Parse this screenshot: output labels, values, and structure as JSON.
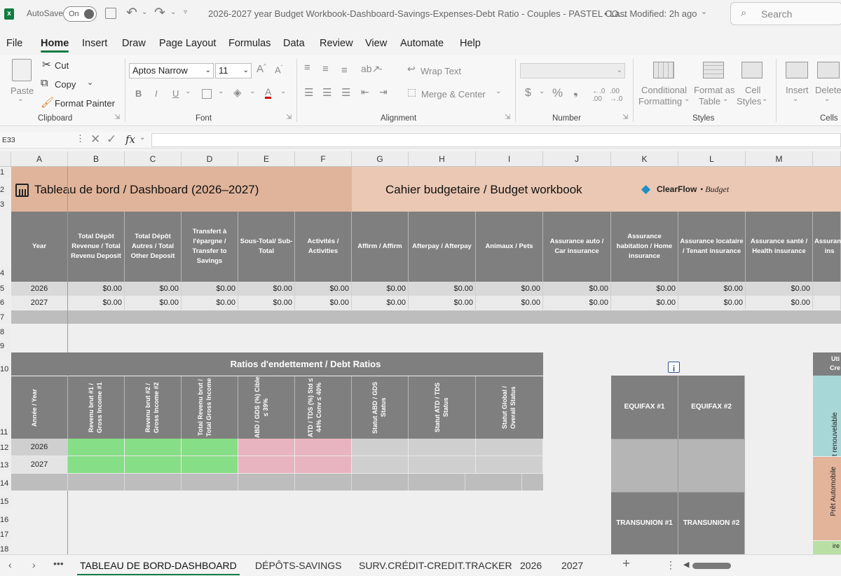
{
  "titlebar": {
    "autosave_label": "AutoSave",
    "autosave_state": "On",
    "doc_title": "2026-2027 year Budget Workbook-Dashboard-Savings-Expenses-Debt Ratio - Couples - PASTEL CO...",
    "last_modified": "• Last Modified: 2h ago",
    "search_placeholder": "Search"
  },
  "menu": [
    "File",
    "Home",
    "Insert",
    "Draw",
    "Page Layout",
    "Formulas",
    "Data",
    "Review",
    "View",
    "Automate",
    "Help"
  ],
  "ribbon": {
    "clipboard": {
      "paste": "Paste",
      "cut": "Cut",
      "copy": "Copy",
      "format_painter": "Format Painter",
      "group": "Clipboard"
    },
    "font": {
      "family": "Aptos Narrow",
      "size": "11",
      "group": "Font"
    },
    "alignment": {
      "wrap": "Wrap Text",
      "merge": "Merge & Center",
      "group": "Alignment"
    },
    "number": {
      "group": "Number"
    },
    "styles": {
      "conditional": "Conditional",
      "formatting": "Formatting",
      "format_as": "Format as",
      "table": "Table",
      "cell": "Cell",
      "styles": "Styles",
      "group": "Styles"
    },
    "cells": {
      "insert": "Insert",
      "delete": "Delete",
      "group": "Cells"
    }
  },
  "formula_bar": {
    "name_box": "E33",
    "fx": "fx"
  },
  "columns": [
    "A",
    "B",
    "C",
    "D",
    "E",
    "F",
    "G",
    "H",
    "I",
    "J",
    "K",
    "L",
    "M"
  ],
  "rows": [
    "1",
    "2",
    "3",
    "4",
    "5",
    "6",
    "7",
    "8",
    "9",
    "10",
    "11",
    "12",
    "13",
    "14",
    "15",
    "16",
    "17",
    "18"
  ],
  "sheet": {
    "dashboard_title": "Tableau de bord / Dashboard  (2026–2027)",
    "workbook_title": "Cahier budgetaire  / Budget workbook",
    "brand": "ClearFlow",
    "brand_suffix": "• Budget",
    "headers": [
      "Year",
      "Total Dépôt Revenue / Total Revenu Deposit",
      "Total Dépôt Autres / Total Other Deposit",
      "Transfert à l'épargne / Transfer to Savings",
      "Sous-Total/ Sub-Total",
      "Activités / Activities",
      "Affirm / Affirm",
      "Afterpay / Afterpay",
      "Animaux / Pets",
      "Assurance auto / Car insurance",
      "Assurance habitation / Home insurance",
      "Assurance locataire / Tenant insurance",
      "Assurance santé / Health insurance",
      "Assuranc ins"
    ],
    "data_rows": [
      {
        "year": "2026",
        "values": [
          "$0.00",
          "$0.00",
          "$0.00",
          "$0.00",
          "$0.00",
          "$0.00",
          "$0.00",
          "$0.00",
          "$0.00",
          "$0.00",
          "$0.00",
          "$0.00"
        ]
      },
      {
        "year": "2027",
        "values": [
          "$0.00",
          "$0.00",
          "$0.00",
          "$0.00",
          "$0.00",
          "$0.00",
          "$0.00",
          "$0.00",
          "$0.00",
          "$0.00",
          "$0.00",
          "$0.00"
        ]
      }
    ],
    "debt_title": "Ratios d'endettement / Debt Ratios",
    "debt_headers": [
      "Année / Year",
      "Revenu brut #1 / Gross Income #1",
      "Revenu brut #2 / Gross Income #2",
      "Total Revenu brut / Total Gross Income",
      "ABD / GDS (%) Cible ≤ 39%",
      "ATD / TDS (%) Std ≤ 44% Conv ≤ 40%",
      "Statut ABD / GDS Status",
      "Statut ATD / TDS Status",
      "Statut Global / Overall Status"
    ],
    "debt_years": [
      "2026",
      "2027"
    ],
    "credit": {
      "info": "i",
      "equifax1": "EQUIFAX #1",
      "equifax2": "EQUIFAX #2",
      "transunion1": "TRANSUNION #1",
      "transunion2": "TRANSUNION #2"
    },
    "side_labels": {
      "top_a": "Uti",
      "top_b": "Cre",
      "teal": "Crédit renouvelable",
      "salmon": "Prêt Automobile",
      "green": "ire"
    }
  },
  "tabs": [
    "TABLEAU DE BORD-DASHBOARD",
    "DÉPÔTS-SAVINGS",
    "SURV.CRÉDIT-CREDIT.TRACKER",
    "2026",
    "2027"
  ],
  "colors": {
    "accent": "#107c41",
    "header_salmon": "#e0b49a",
    "header_peach": "#ebc8b4",
    "dark_gray": "#7f7f7f",
    "green_cell": "#86df86",
    "pink_cell": "#e8b4bf",
    "teal": "#a7d7d6"
  }
}
